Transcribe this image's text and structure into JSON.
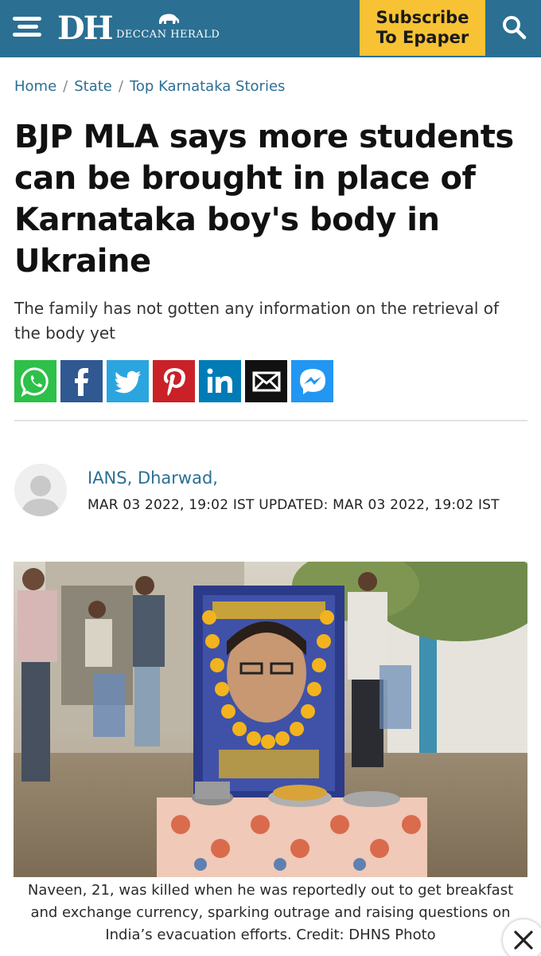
{
  "header": {
    "logo_initials": "DH",
    "logo_name": "DECCAN HERALD",
    "subscribe_line1": "Subscribe",
    "subscribe_line2": "To Epaper",
    "menu_icon": "hamburger-menu-icon",
    "search_icon": "search-icon",
    "bg_color": "#2b6f93",
    "subscribe_color": "#f7c234"
  },
  "breadcrumb": {
    "items": [
      "Home",
      "State",
      "Top Karnataka Stories"
    ],
    "separator": "/"
  },
  "article": {
    "headline": "BJP MLA says more students can be brought in place of Karnataka boy's body in Ukraine",
    "subheadline": "The family has not gotten any information on the retrieval of the body yet",
    "author": "IANS, Dharwad,",
    "dateline": "MAR 03 2022, 19:02 IST UPDATED: MAR 03 2022, 19:02 IST",
    "photo_caption": "Naveen, 21, was killed when he was reportedly out to get breakfast and exchange currency, sparking outrage and raising questions on India’s evacuation efforts. Credit: DHNS Photo"
  },
  "share": {
    "buttons": [
      {
        "name": "whatsapp",
        "icon": "whatsapp-icon",
        "color": "#2ec049"
      },
      {
        "name": "facebook",
        "icon": "facebook-icon",
        "color": "#305891"
      },
      {
        "name": "twitter",
        "icon": "twitter-icon",
        "color": "#2ba5e0"
      },
      {
        "name": "pinterest",
        "icon": "pinterest-icon",
        "color": "#ca2128"
      },
      {
        "name": "linkedin",
        "icon": "linkedin-icon",
        "color": "#007bb6"
      },
      {
        "name": "email",
        "icon": "email-icon",
        "color": "#111111"
      },
      {
        "name": "messenger",
        "icon": "messenger-icon",
        "color": "#2196f3"
      }
    ]
  },
  "overlay": {
    "close_icon": "close-icon"
  }
}
